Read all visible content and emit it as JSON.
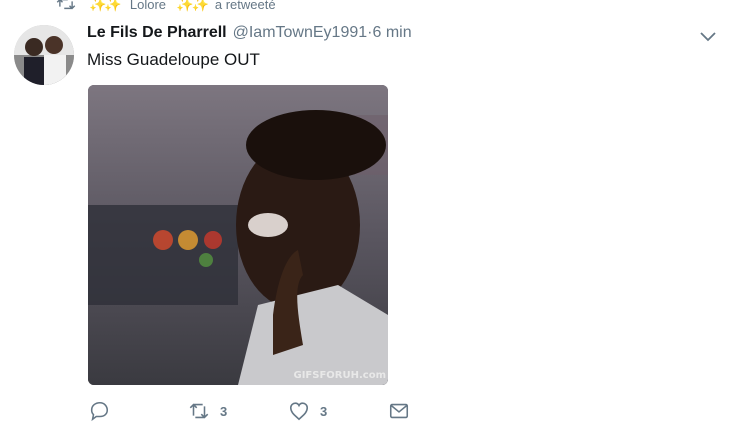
{
  "retweet_context": {
    "icon": "retweet-icon",
    "emoji_left": "✨✨",
    "user": "Lolore",
    "emoji_right": "✨✨",
    "action": "a retweeté"
  },
  "tweet": {
    "display_name": "Le Fils De Pharrell",
    "handle": "@IamTownEy1991",
    "separator": " · ",
    "time": "6 min",
    "text": "Miss Guadeloupe OUT",
    "media": {
      "type": "gif",
      "watermark": "GIFSFORUH.com"
    }
  },
  "actions": {
    "reply": {
      "icon": "reply-icon",
      "count": ""
    },
    "retweet": {
      "icon": "retweet-icon",
      "count": "3"
    },
    "like": {
      "icon": "heart-icon",
      "count": "3"
    },
    "dm": {
      "icon": "envelope-icon"
    }
  },
  "colors": {
    "text": "#14171a",
    "secondary": "#657786",
    "accent": "#f5a623"
  }
}
